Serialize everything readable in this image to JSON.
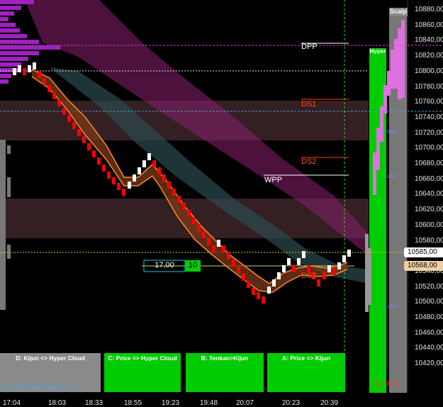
{
  "chart": {
    "price_axis": [
      "10880,00",
      "10860,00",
      "10840,00",
      "10820,00",
      "10800,00",
      "10780,00",
      "10760,00",
      "10740,00",
      "10720,00",
      "10700,00",
      "10680,00",
      "10660,00",
      "10640,00",
      "10620,00",
      "10600,00",
      "10580,00",
      "10560,00",
      "10540,00",
      "10520,00",
      "10500,00",
      "10480,00",
      "10460,00",
      "10440,00",
      "10420,00"
    ],
    "time_axis": [
      "17:04",
      "18:03",
      "18:33",
      "18:55",
      "19:23",
      "19:48",
      "20:07",
      "20:23",
      "20:39"
    ],
    "levels": {
      "dpp": "DPP",
      "ds1": "DS1",
      "ds2": "DS2",
      "wpp": "WPP",
      "ds3": "DS3"
    },
    "current_price": "10585,00",
    "reference_price": "10568,00",
    "order_qty": "17,00",
    "order_count": "10",
    "scalp_label": "Scalp",
    "hyper_label": "Hyper",
    "pnl_text": "-2 79,25",
    "percent_labels": [
      "0.00%",
      "0.00%",
      "0.00%"
    ],
    "copyright": "© 2020 NinjaTrader, LLC",
    "colors": {
      "background": "#000000",
      "up_bar": "#ffffff",
      "down_bar": "#ff0000",
      "panel_green": "#00cc00",
      "panel_gray": "#8a8a8a",
      "cloud_magenta": "#8b1f6e",
      "cloud_teal": "#2b4a4f",
      "dpp_line": "#d040d0"
    }
  },
  "panels": [
    {
      "label": "D: Kijun <> Hyper Cloud",
      "state": "gray"
    },
    {
      "label": "C: Price <> Hyper Cloud",
      "state": "green"
    },
    {
      "label": "B: Tenkan>Kijun",
      "state": "green"
    },
    {
      "label": "A: Price <> Kijun",
      "state": "green"
    }
  ]
}
